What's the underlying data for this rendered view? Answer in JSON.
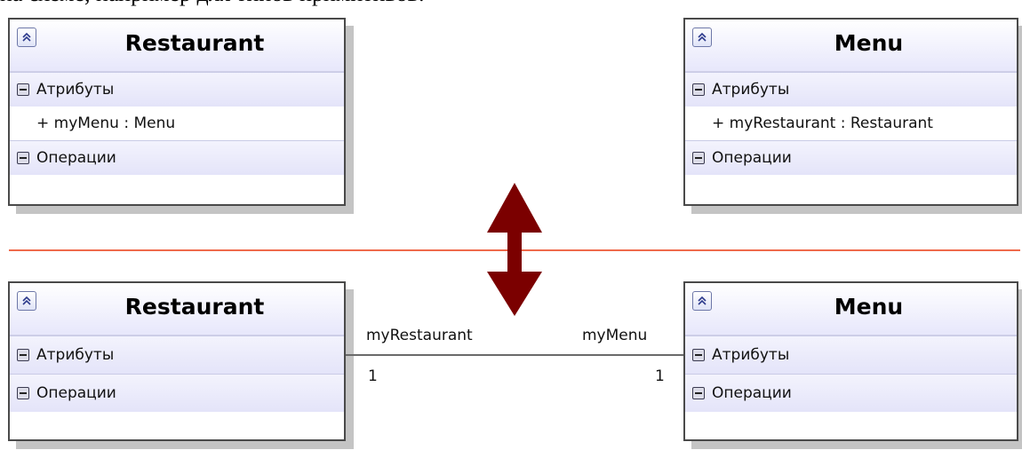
{
  "caption_text": "на схеме, например для типов примитивов.",
  "top_diagram": {
    "restaurant": {
      "title": "Restaurant",
      "attributes_label": "Атрибуты",
      "attribute": "+ myMenu : Menu",
      "operations_label": "Операции"
    },
    "menu": {
      "title": "Menu",
      "attributes_label": "Атрибуты",
      "attribute": "+ myRestaurant : Restaurant",
      "operations_label": "Операции"
    }
  },
  "bottom_diagram": {
    "restaurant": {
      "title": "Restaurant",
      "attributes_label": "Атрибуты",
      "operations_label": "Операции"
    },
    "menu": {
      "title": "Menu",
      "attributes_label": "Атрибуты",
      "operations_label": "Операции"
    },
    "association": {
      "left_role": "myRestaurant",
      "right_role": "myMenu",
      "left_multiplicity": "1",
      "right_multiplicity": "1"
    }
  },
  "colors": {
    "arrow": "#7b0000",
    "divider": "#ef6a4c",
    "box_border": "#4a4a4a",
    "shadow": "#c4c4c4"
  }
}
